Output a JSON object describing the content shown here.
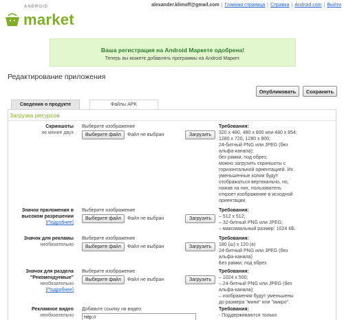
{
  "header": {
    "logo_small": "ANDROID",
    "logo_big": "market",
    "email": "alexander.klimoff@gmail.com",
    "links": [
      "Главная страница",
      "Справка",
      "Android.com",
      "Выйти"
    ],
    "separator": "|"
  },
  "notice": {
    "title": "Ваша регистрация на Android Маркете одобрена!",
    "text": "Теперь вы можете добавлять программы на Android Маркет."
  },
  "page_title": "Редактирование приложения",
  "buttons": {
    "publish": "Опубликовать",
    "save": "Сохранить"
  },
  "tabs": [
    "Сведения о продукте",
    "Файлы APK"
  ],
  "section_title": "Загрузка ресурсов",
  "file_common": {
    "choose_caption": "Выберите изображение",
    "choose_button": "Выберите файл",
    "no_file": "Файл не выбран",
    "upload": "Загрузить"
  },
  "rows": [
    {
      "title": [
        "Скриншоты"
      ],
      "sub": "не менее двух",
      "link": "",
      "req_title": "Требования:",
      "req_lines": [
        "320 x 480, 480 x 800 или 480 x 854;",
        "1280 x 720, 1280 x 800;",
        "24-битный PNG или JPEG (без",
        "альфа-канала);",
        "без рамки, под обрез;",
        "можно загрузить скриншоты с",
        "горизонтальной ориентацией. Их",
        "уменьшенные копии будут",
        "отображаться вертикально, но,",
        "нажав на них, пользователь",
        "откроет изображение в исходной",
        "ориентации."
      ]
    },
    {
      "title": [
        "Значок приложения в",
        "высоком разрешении"
      ],
      "sub": "",
      "link": "[Подробнее]",
      "req_title": "Требования:",
      "req_lines": [
        "– 512 x 512;",
        "– 32-битный PNG или JPEG;",
        "– максимальный размер: 1024 КБ."
      ]
    },
    {
      "title": [
        "Значок для рекламы"
      ],
      "sub": "необязательно",
      "link": "",
      "req_title": "Требования:",
      "req_lines": [
        "180 (ш) x 120 (в)",
        "24-битный PNG или JPEG (без",
        "альфа-канала)",
        "Без рамки, под обрез"
      ]
    },
    {
      "title": [
        "Значок для раздела",
        "\"Рекомендуемые\""
      ],
      "sub": "необязательно",
      "link": "[Подробнее]",
      "req_title": "Требования:",
      "req_lines": [
        "– 1024 x 500;",
        "– 24-битный PNG или JPEG (без",
        "альфа-канала);",
        "– изображения будут уменьшены",
        "до размера \"мини\" или \"микро\"."
      ]
    }
  ],
  "video": {
    "title": "Рекламное видео",
    "sub": "необязательно",
    "caption": "Добавьте ссылку на видео",
    "value": "http://",
    "req_title": "Требования:",
    "req_lines": [
      "- Поддерживаются только"
    ]
  },
  "colors": {
    "brand_green": "#7fae27",
    "notice_bg": "#e3f7cf",
    "link_blue": "#2a62c9"
  }
}
